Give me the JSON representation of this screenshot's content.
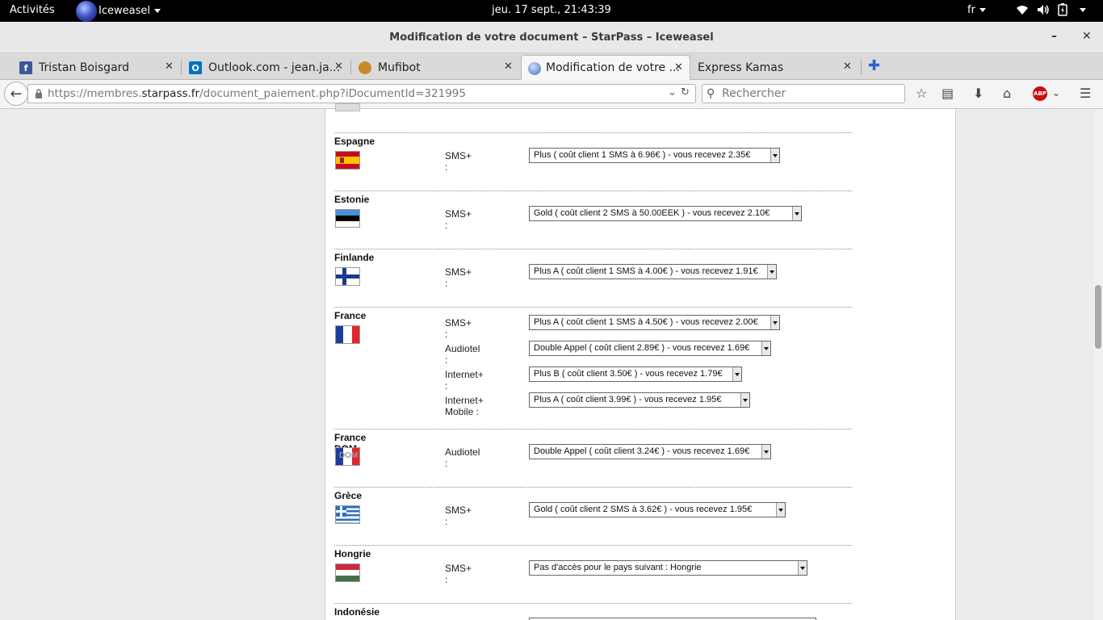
{
  "topbar": {
    "activities": "Activités",
    "app_name": "Iceweasel",
    "clock": "jeu. 17 sept., 21:43:39",
    "lang": "fr"
  },
  "window": {
    "title": "Modification de votre document – StarPass – Iceweasel",
    "minimize": "–",
    "close": "✕"
  },
  "tabs": [
    {
      "label": "Tristan Boisgard",
      "icon": "facebook-icon",
      "color": "#3b5998"
    },
    {
      "label": "Outlook.com - jean.ja...",
      "icon": "outlook-icon",
      "color": "#0072c6"
    },
    {
      "label": "Mufibot",
      "icon": "muffin-icon",
      "color": "#c98a2e"
    },
    {
      "label": "Modification de votre ...",
      "icon": "globe-icon",
      "color": "#3a6fb5"
    },
    {
      "label": "Express Kamas",
      "icon": "blank-icon",
      "color": "#ffffff"
    }
  ],
  "nav": {
    "url_prefix": "https://membres.",
    "url_domain": "starpass.fr",
    "url_path": "/document_paiement.php?iDocumentId=321995",
    "search_placeholder": "Rechercher"
  },
  "countries": [
    {
      "name": "Espagne",
      "flag": "es",
      "rows": [
        {
          "label": "SMS+ :",
          "value": "Plus ( coût client 1 SMS à 6.96€ ) - vous recevez 2.35€"
        }
      ]
    },
    {
      "name": "Estonie",
      "flag": "ee",
      "rows": [
        {
          "label": "SMS+ :",
          "value": "Gold ( coût client 2 SMS à 50.00EEK ) - vous recevez 2.10€"
        }
      ]
    },
    {
      "name": "Finlande",
      "flag": "fi",
      "rows": [
        {
          "label": "SMS+ :",
          "value": "Plus A ( coût client 1 SMS à 4.00€ ) - vous recevez 1.91€"
        }
      ]
    },
    {
      "name": "France",
      "flag": "fr",
      "rows": [
        {
          "label": "SMS+ :",
          "value": "Plus A ( coût client 1 SMS à 4.50€ ) - vous recevez 2.00€"
        },
        {
          "label": "Audiotel :",
          "value": "Double Appel ( coût client 2.89€ ) - vous recevez 1.69€"
        },
        {
          "label": "Internet+ :",
          "value": "Plus B ( coût client 3.50€ ) - vous recevez 1.79€"
        },
        {
          "label": "Internet+ Mobile :",
          "value": "Plus A ( coût client 3.99€ ) - vous recevez 1.95€"
        }
      ]
    },
    {
      "name": "France DOM",
      "flag": "dom",
      "flag_text": "DOM",
      "rows": [
        {
          "label": "Audiotel :",
          "value": "Double Appel ( coût client 3.24€ ) - vous recevez 1.69€"
        }
      ]
    },
    {
      "name": "Grèce",
      "flag": "gr",
      "rows": [
        {
          "label": "SMS+ :",
          "value": "Gold ( coût client 2 SMS à 3.62€ ) - vous recevez 1.95€"
        }
      ]
    },
    {
      "name": "Hongrie",
      "flag": "hu",
      "rows": [
        {
          "label": "SMS+ :",
          "value": "Pas d'accès pour le pays suivant : Hongrie"
        }
      ]
    },
    {
      "name": "Indonésie",
      "flag": "id",
      "rows": []
    }
  ]
}
